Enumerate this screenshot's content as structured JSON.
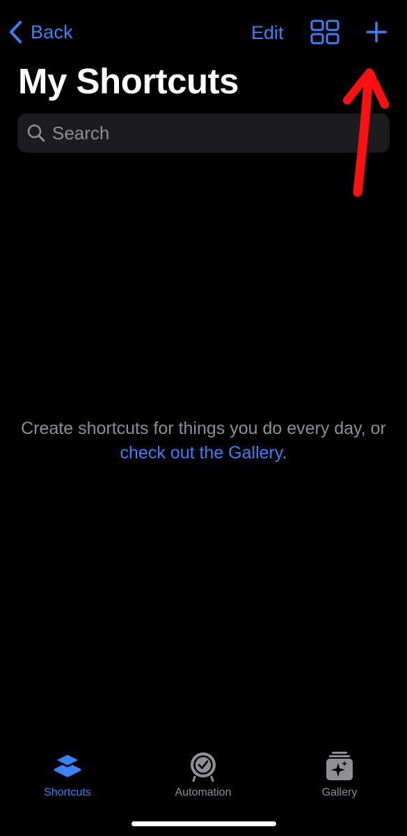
{
  "nav": {
    "back_label": "Back",
    "edit_label": "Edit",
    "grid_icon": "grid-view-icon",
    "add_icon": "plus-icon"
  },
  "page_title": "My Shortcuts",
  "search": {
    "placeholder": "Search",
    "value": ""
  },
  "empty_state": {
    "text": "Create shortcuts for things you do every day, or ",
    "link": "check out the Gallery",
    "suffix": "."
  },
  "tabs": [
    {
      "label": "Shortcuts",
      "icon": "shortcuts-layers-icon",
      "selected": true
    },
    {
      "label": "Automation",
      "icon": "automation-clock-icon",
      "selected": false
    },
    {
      "label": "Gallery",
      "icon": "gallery-sparkle-icon",
      "selected": false
    }
  ],
  "colors": {
    "accent": "#3b82f6",
    "background": "#000000",
    "secondary_text": "#8e8e93",
    "search_fill": "#1c1c1e",
    "annotation": "#ff1010"
  }
}
